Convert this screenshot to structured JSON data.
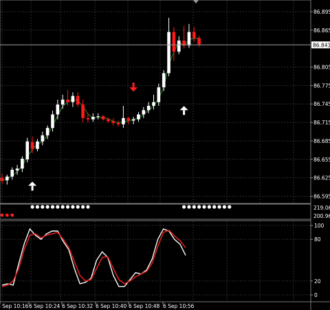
{
  "chart_data": [
    {
      "type": "candlestick",
      "panel": "price",
      "price_ticks": [
        "86.895",
        "86.865",
        "86.841",
        "86.805",
        "86.775",
        "86.745",
        "86.715",
        "86.685",
        "86.655",
        "86.625",
        "86.595"
      ],
      "current_price": "86.841",
      "ylim": [
        86.59,
        86.905
      ],
      "candles": [
        {
          "o": 86.625,
          "h": 86.632,
          "l": 86.615,
          "c": 86.62
        },
        {
          "o": 86.621,
          "h": 86.63,
          "l": 86.614,
          "c": 86.627
        },
        {
          "o": 86.627,
          "h": 86.642,
          "l": 86.622,
          "c": 86.638
        },
        {
          "o": 86.637,
          "h": 86.646,
          "l": 86.63,
          "c": 86.64
        },
        {
          "o": 86.64,
          "h": 86.66,
          "l": 86.634,
          "c": 86.656
        },
        {
          "o": 86.655,
          "h": 86.69,
          "l": 86.65,
          "c": 86.684
        },
        {
          "o": 86.683,
          "h": 86.692,
          "l": 86.665,
          "c": 86.672
        },
        {
          "o": 86.672,
          "h": 86.688,
          "l": 86.668,
          "c": 86.684
        },
        {
          "o": 86.684,
          "h": 86.7,
          "l": 86.678,
          "c": 86.694
        },
        {
          "o": 86.694,
          "h": 86.71,
          "l": 86.688,
          "c": 86.706
        },
        {
          "o": 86.706,
          "h": 86.734,
          "l": 86.7,
          "c": 86.728
        },
        {
          "o": 86.728,
          "h": 86.752,
          "l": 86.72,
          "c": 86.744
        },
        {
          "o": 86.744,
          "h": 86.76,
          "l": 86.737,
          "c": 86.752
        },
        {
          "o": 86.752,
          "h": 86.768,
          "l": 86.742,
          "c": 86.748
        },
        {
          "o": 86.748,
          "h": 86.764,
          "l": 86.74,
          "c": 86.758
        },
        {
          "o": 86.758,
          "h": 86.764,
          "l": 86.74,
          "c": 86.744
        },
        {
          "o": 86.744,
          "h": 86.752,
          "l": 86.715,
          "c": 86.722
        },
        {
          "o": 86.722,
          "h": 86.73,
          "l": 86.715,
          "c": 86.72
        },
        {
          "o": 86.72,
          "h": 86.73,
          "l": 86.716,
          "c": 86.724
        },
        {
          "o": 86.724,
          "h": 86.73,
          "l": 86.72,
          "c": 86.725
        },
        {
          "o": 86.725,
          "h": 86.727,
          "l": 86.718,
          "c": 86.72
        },
        {
          "o": 86.72,
          "h": 86.723,
          "l": 86.714,
          "c": 86.717
        },
        {
          "o": 86.717,
          "h": 86.722,
          "l": 86.71,
          "c": 86.714
        },
        {
          "o": 86.714,
          "h": 86.718,
          "l": 86.708,
          "c": 86.712
        },
        {
          "o": 86.712,
          "h": 86.742,
          "l": 86.706,
          "c": 86.722
        },
        {
          "o": 86.722,
          "h": 86.724,
          "l": 86.712,
          "c": 86.718
        },
        {
          "o": 86.718,
          "h": 86.724,
          "l": 86.712,
          "c": 86.72
        },
        {
          "o": 86.72,
          "h": 86.732,
          "l": 86.716,
          "c": 86.728
        },
        {
          "o": 86.728,
          "h": 86.74,
          "l": 86.722,
          "c": 86.735
        },
        {
          "o": 86.735,
          "h": 86.748,
          "l": 86.73,
          "c": 86.742
        },
        {
          "o": 86.742,
          "h": 86.76,
          "l": 86.736,
          "c": 86.748
        },
        {
          "o": 86.748,
          "h": 86.778,
          "l": 86.742,
          "c": 86.772
        },
        {
          "o": 86.772,
          "h": 86.8,
          "l": 86.766,
          "c": 86.795
        },
        {
          "o": 86.795,
          "h": 86.885,
          "l": 86.79,
          "c": 86.862
        },
        {
          "o": 86.862,
          "h": 86.87,
          "l": 86.815,
          "c": 86.83
        },
        {
          "o": 86.83,
          "h": 86.855,
          "l": 86.826,
          "c": 86.848
        },
        {
          "o": 86.848,
          "h": 86.872,
          "l": 86.835,
          "c": 86.84
        },
        {
          "o": 86.84,
          "h": 86.875,
          "l": 86.836,
          "c": 86.862
        },
        {
          "o": 86.862,
          "h": 86.87,
          "l": 86.846,
          "c": 86.852
        },
        {
          "o": 86.852,
          "h": 86.856,
          "l": 86.838,
          "c": 86.842
        }
      ],
      "arrows": [
        {
          "type": "buy",
          "candle": 6,
          "price": 86.612
        },
        {
          "type": "sell",
          "candle": 26,
          "price": 86.772
        },
        {
          "type": "buy",
          "candle": 36,
          "price": 86.735
        }
      ]
    },
    {
      "type": "dots",
      "panel": "signal",
      "scale_labels": [
        "219.06",
        "200.96"
      ],
      "red_dots_start": 0,
      "red_dots_count": 3,
      "white_group_1_start": 6,
      "white_group_1_count": 12,
      "white_group_2_start": 36,
      "white_group_2_count": 10
    },
    {
      "type": "line",
      "panel": "stochastic",
      "y_ticks": [
        "100",
        "80",
        "20",
        "0"
      ],
      "ylim": [
        -5,
        105
      ],
      "series": [
        {
          "color": "#ffffff",
          "values": [
            14,
            16,
            14,
            45,
            74,
            95,
            86,
            80,
            88,
            92,
            92,
            77,
            65,
            38,
            16,
            18,
            24,
            50,
            62,
            54,
            28,
            12,
            12,
            22,
            32,
            30,
            36,
            52,
            80,
            95,
            92,
            80,
            73,
            57
          ]
        },
        {
          "color": "#e02020",
          "values": [
            12,
            14,
            20,
            38,
            66,
            86,
            88,
            82,
            86,
            88,
            90,
            80,
            68,
            48,
            28,
            20,
            22,
            38,
            54,
            55,
            38,
            22,
            16,
            20,
            26,
            30,
            34,
            46,
            70,
            90,
            93,
            85,
            78,
            68
          ]
        }
      ]
    }
  ],
  "time_labels": [
    "6 Sep 10:16",
    "6 Sep 10:24",
    "6 Sep 10:32",
    "6 Sep 10:40",
    "6 Sep 10:48",
    "6 Sep 10:56"
  ],
  "colors": {
    "bull": "#ffffff",
    "bear": "#ff1a1a",
    "grid": "#2e2e2e",
    "buy_arrow": "#ffffff",
    "sell_arrow": "#ff2020",
    "ma": "#2e8b2e"
  }
}
